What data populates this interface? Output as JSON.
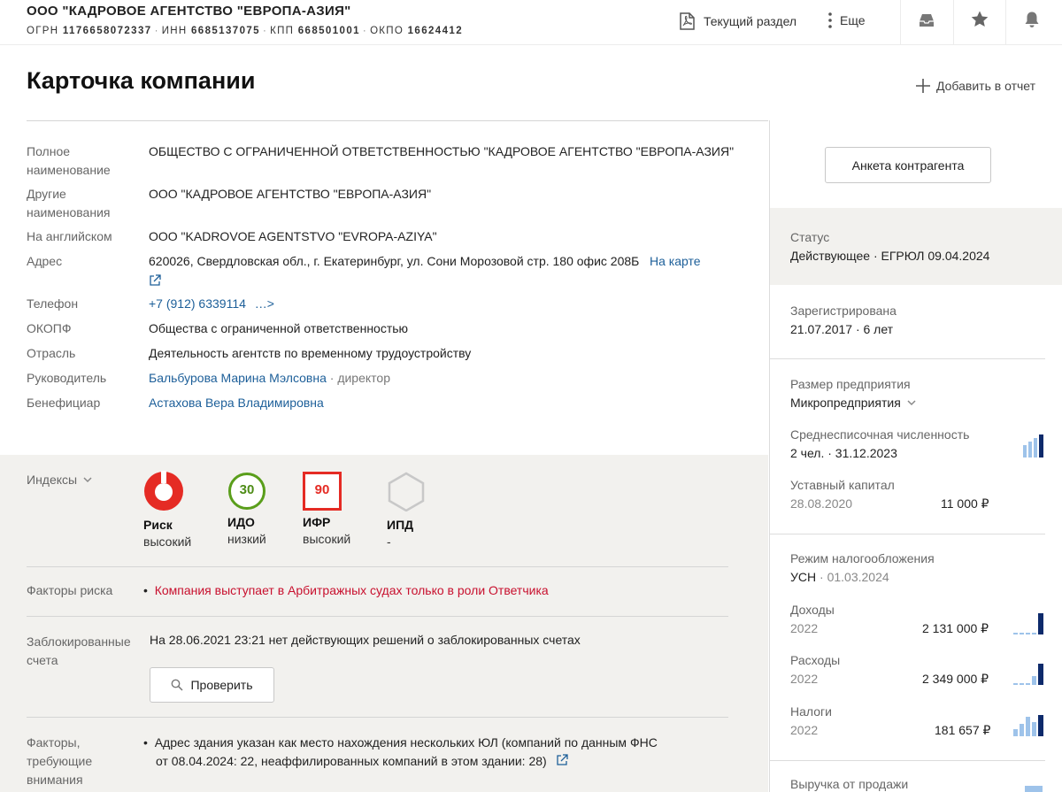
{
  "header": {
    "company_short": "ООО \"КАДРОВОЕ АГЕНТСТВО \"ЕВРОПА-АЗИЯ\"",
    "requisites": [
      {
        "label": "ОГРН",
        "value": "1176658072337"
      },
      {
        "label": "ИНН",
        "value": "6685137075"
      },
      {
        "label": "КПП",
        "value": "668501001"
      },
      {
        "label": "ОКПО",
        "value": "16624412"
      }
    ],
    "current_section_label": "Текущий раздел",
    "more_label": "Еще"
  },
  "page": {
    "title": "Карточка компании",
    "add_report_label": "Добавить в отчет"
  },
  "details": {
    "full_name_label_1": "Полное",
    "full_name_label_2": "наименование",
    "full_name_value": "ОБЩЕСТВО С ОГРАНИЧЕННОЙ ОТВЕТСТВЕННОСТЬЮ \"КАДРОВОЕ АГЕНТСТВО \"ЕВРОПА-АЗИЯ\"",
    "other_names_label_1": "Другие",
    "other_names_label_2": "наименования",
    "other_names_value": "ООО \"КАДРОВОЕ АГЕНТСТВО \"ЕВРОПА-АЗИЯ\"",
    "english_label": "На английском",
    "english_value": "ООО \"KADROVOE AGENTSTVO \"EVROPA-AZIYA\"",
    "address_label": "Адрес",
    "address_value": "620026, Свердловская обл., г. Екатеринбург, ул. Сони Морозовой стр. 180 офис 208Б",
    "map_link": "На карте",
    "phone_label": "Телефон",
    "phone_value": "+7 (912) 6339114",
    "phone_more": "…>",
    "okopf_label": "ОКОПФ",
    "okopf_value": "Общества с ограниченной ответственностью",
    "industry_label": "Отрасль",
    "industry_value": "Деятельность агентств по временному трудоустройству",
    "head_label": "Руководитель",
    "head_name": "Бальбурова Марина Мэлсовна",
    "head_role": "· директор",
    "beneficiary_label": "Бенефициар",
    "beneficiary_name": "Астахова Вера Владимировна"
  },
  "indexes": {
    "label": "Индексы",
    "items": [
      {
        "name": "Риск",
        "level": "высокий",
        "badge": "",
        "color": "#e52b24"
      },
      {
        "name": "ИДО",
        "level": "низкий",
        "badge": "30",
        "color": "#5a9e1b"
      },
      {
        "name": "ИФР",
        "level": "высокий",
        "badge": "90",
        "color": "#e52b24"
      },
      {
        "name": "ИПД",
        "level": "-",
        "badge": "",
        "color": "#c8c8c8"
      }
    ]
  },
  "risk_factors": {
    "label": "Факторы риска",
    "text": "Компания выступает в Арбитражных судах только в роли Ответчика"
  },
  "blocked_accounts": {
    "label_1": "Заблокированные",
    "label_2": "счета",
    "text": "На 28.06.2021 23:21 нет действующих решений о заблокированных счетах",
    "check_button": "Проверить"
  },
  "attention_factors": {
    "label_1": "Факторы,",
    "label_2": "требующие",
    "label_3": "внимания",
    "text_1": "Адрес здания указан как место нахождения нескольких ЮЛ (компаний по данным ФНС",
    "text_2": "от 08.04.2024: 22, неаффилированных компаний в этом здании: 28)"
  },
  "right": {
    "anketa_button": "Анкета контрагента",
    "status_label": "Статус",
    "status_value": "Действующее · ЕГРЮЛ 09.04.2024",
    "registered_label": "Зарегистрирована",
    "registered_value": "21.07.2017 · 6 лет",
    "size_label": "Размер предприятия",
    "size_value": "Микропредприятия",
    "headcount_label": "Среднесписочная численность",
    "headcount_value": "2 чел. · 31.12.2023",
    "capital_label": "Уставный капитал",
    "capital_date": "28.08.2020",
    "capital_value": "11 000 ₽",
    "tax_label": "Режим налогообложения",
    "tax_value": "УСН",
    "tax_date": "· 01.03.2024",
    "income_label": "Доходы",
    "income_year": "2022",
    "income_value": "2 131 000 ₽",
    "expense_label": "Расходы",
    "expense_year": "2022",
    "expense_value": "2 349 000 ₽",
    "taxes_label": "Налоги",
    "taxes_year": "2022",
    "taxes_value": "181 657 ₽",
    "revenue_label": "Выручка от продажи"
  },
  "colors": {
    "link": "#1d5f99",
    "risk_red": "#c8102e",
    "bar_light": "#9ec3ea",
    "bar_dark": "#0d2a6b"
  }
}
